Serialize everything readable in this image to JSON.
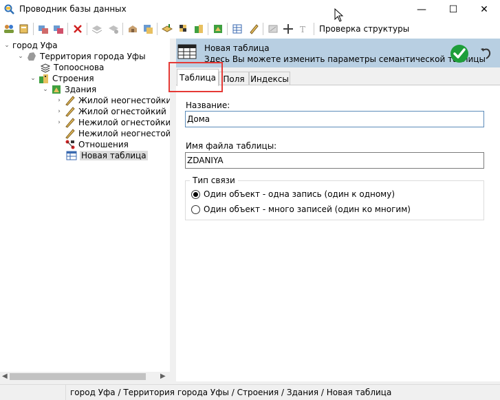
{
  "window": {
    "title": "Проводник базы данных",
    "controls": {
      "minimize": "—",
      "maximize": "☐",
      "close": "✕"
    }
  },
  "toolbar": {
    "check_structure_label": "Проверка структуры"
  },
  "tree": {
    "items": [
      {
        "label": "город Уфа",
        "icon": "database-icon"
      },
      {
        "label": "Территория города Уфы",
        "icon": "map-icon"
      },
      {
        "label": "Топооснова",
        "icon": "layers-icon"
      },
      {
        "label": "Строения",
        "icon": "buildings-icon"
      },
      {
        "label": "Здания",
        "icon": "building-icon"
      },
      {
        "label": "Жилой неогнестойкий",
        "icon": "pencil-icon"
      },
      {
        "label": "Жилой огнестойкий",
        "icon": "pencil-icon"
      },
      {
        "label": "Нежилой огнестойкий",
        "icon": "pencil-icon"
      },
      {
        "label": "Нежилой неогнестойк",
        "icon": "pencil-icon"
      },
      {
        "label": "Отношения",
        "icon": "relations-icon"
      },
      {
        "label": "Новая таблица",
        "icon": "table-icon"
      }
    ]
  },
  "header": {
    "title": "Новая таблица",
    "subtitle": "Здесь Вы можете изменить параметры семантической таблицы"
  },
  "tabs": [
    {
      "label": "Таблица",
      "active": true
    },
    {
      "label": "Поля",
      "active": false
    },
    {
      "label": "Индексы",
      "active": false
    }
  ],
  "form": {
    "name_label": "Название:",
    "name_value": "Дома",
    "file_label": "Имя файла таблицы:",
    "file_value": "ZDANIYA",
    "link_group_label": "Тип связи",
    "options": [
      {
        "label": "Один объект - одна запись (один к одному)",
        "selected": true
      },
      {
        "label": "Один объект - много записей (один ко многим)",
        "selected": false
      }
    ]
  },
  "statusbar": {
    "path": "город Уфа / Территория города Уфы / Строения / Здания / Новая таблица"
  },
  "colors": {
    "header_bg": "#b8cfe2",
    "highlight": "#e53935",
    "ok_green": "#1e9e3a"
  }
}
